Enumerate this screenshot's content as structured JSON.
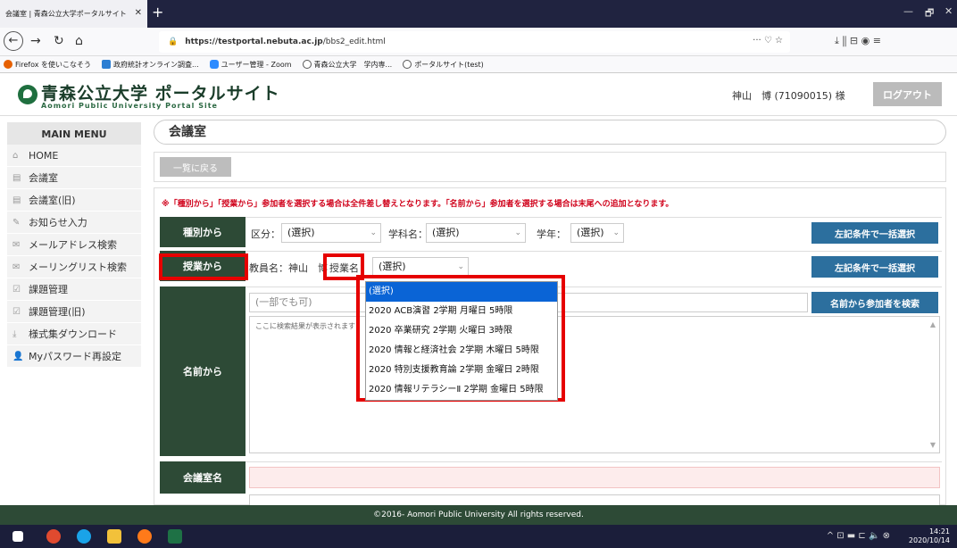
{
  "browser": {
    "tab_title": "会議室 | 青森公立大学ポータルサイト",
    "tab_close": "✕",
    "new_tab": "+",
    "win_min": "—",
    "win_max": "🗗",
    "win_close": "✕",
    "url_host": "https://testportal.nebuta.ac.jp",
    "url_path": "/bbs2_edit.html",
    "url_right_icons": "··· ♡ ☆",
    "nav_right_icons": "⤓   ⫼   ⊟   ◉   ≡",
    "bookmarks": [
      {
        "label": "Firefox を使いこなそう",
        "color": "#e66000"
      },
      {
        "label": "政府統計オンライン調査...",
        "color": "#2d7fd3"
      },
      {
        "label": "ユーザー管理 - Zoom",
        "color": "#2d8cff"
      },
      {
        "label": "青森公立大学　学内専...",
        "color": "#555555"
      },
      {
        "label": "ポータルサイト(test)",
        "color": "#555555"
      }
    ]
  },
  "header": {
    "title": "青森公立大学 ポータルサイト",
    "subtitle": "Aomori Public University Portal Site",
    "user": "神山　博 (71090015) 様",
    "logout": "ログアウト"
  },
  "sidebar": {
    "heading": "MAIN MENU",
    "items": [
      {
        "label": "HOME",
        "icon": "home-icon",
        "glyph": "⌂"
      },
      {
        "label": "会議室",
        "icon": "meeting-icon",
        "glyph": "▤"
      },
      {
        "label": "会議室(旧)",
        "icon": "meeting-old-icon",
        "glyph": "▤"
      },
      {
        "label": "お知らせ入力",
        "icon": "edit-icon",
        "glyph": "✎"
      },
      {
        "label": "メールアドレス検索",
        "icon": "mail-search-icon",
        "glyph": "✉"
      },
      {
        "label": "メーリングリスト検索",
        "icon": "mailing-list-icon",
        "glyph": "✉"
      },
      {
        "label": "課題管理",
        "icon": "task-icon",
        "glyph": "☑"
      },
      {
        "label": "課題管理(旧)",
        "icon": "task-old-icon",
        "glyph": "☑"
      },
      {
        "label": "様式集ダウンロード",
        "icon": "download-icon",
        "glyph": "⤓"
      },
      {
        "label": "Myパスワード再設定",
        "icon": "user-key-icon",
        "glyph": "👤"
      }
    ]
  },
  "main": {
    "page_title": "会議室",
    "back_button": "一覧に戻る",
    "note": "※「種別から」「授業から」参加者を選択する場合は全件差し替えとなります。「名前から」参加者を選択する場合は末尾への追加となります。",
    "by_type": {
      "label": "種別から",
      "division_label": "区分：",
      "division_value": "(選択)",
      "dept_label": "学科名：",
      "dept_value": "(選択)",
      "year_label": "学年：",
      "year_value": "(選択)",
      "button": "左記条件で一括選択"
    },
    "by_class": {
      "label": "授業から",
      "teacher_label": "教員名：神山　博",
      "class_label": "授業名：",
      "class_value": "(選択)",
      "button": "左記条件で一括選択"
    },
    "by_name": {
      "label": "名前から",
      "placeholder": "(一部でも可)",
      "button": "名前から参加者を検索",
      "results_placeholder": "ここに検索結果が表示されます"
    },
    "room_name_label": "会議室名",
    "dropdown_options": [
      "(選択)",
      "2020 ACB演習 2学期 月曜日 5時限",
      "2020 卒業研究 2学期 火曜日 3時限",
      "2020 情報と経済社会 2学期 木曜日 5時限",
      "2020 特別支援教育論 2学期 金曜日 2時限",
      "2020 情報リテラシーⅡ 2学期 金曜日 5時限"
    ]
  },
  "footer": {
    "text": "©2016- Aomori Public University All rights reserved."
  },
  "taskbar": {
    "time": "14:21",
    "date": "2020/10/14",
    "tray_icons": "^ ⊡ ▬ ⊏ 🔈 ⊗"
  }
}
